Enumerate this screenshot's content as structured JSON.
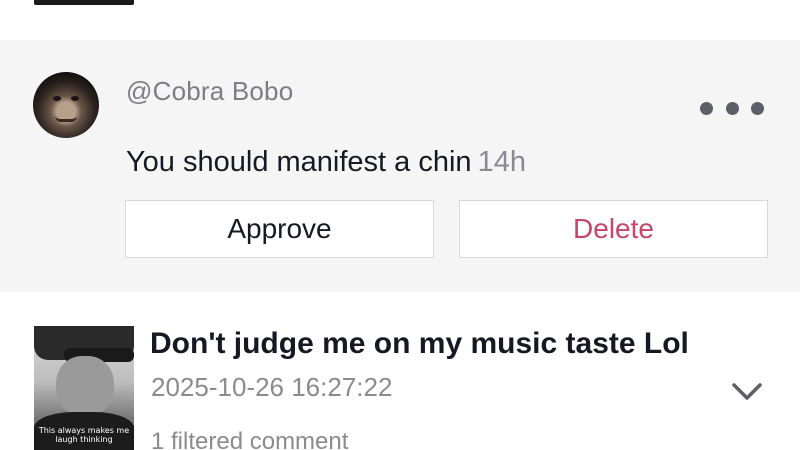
{
  "comment": {
    "username": "@Cobra Bobo",
    "text": "You should manifest a chin",
    "time": "14h",
    "more_icon": "more-horizontal-icon",
    "actions": {
      "approve_label": "Approve",
      "delete_label": "Delete"
    },
    "colors": {
      "card_bg": "#f5f5f5",
      "delete": "#c6466a"
    }
  },
  "video": {
    "title": "Don't judge me on my music taste Lol",
    "date": "2025-10-26 16:27:22",
    "filtered_comments": "1 filtered comment",
    "thumbnail_caption": "This always makes me laugh thinking",
    "expand_icon": "chevron-down-icon"
  }
}
